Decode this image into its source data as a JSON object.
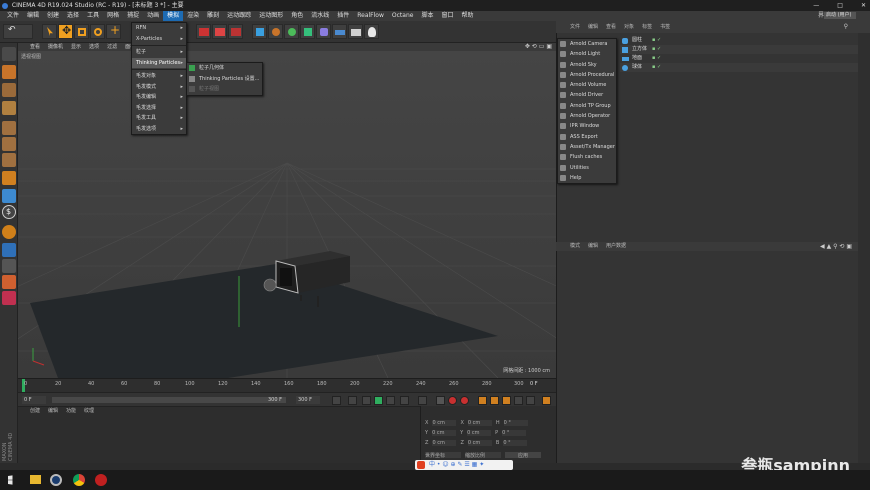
{
  "window": {
    "title": "CINEMA 4D R19.024 Studio (RC - R19) - [未标题 3 *] - 主要",
    "controls": [
      "—",
      "□",
      "✕"
    ]
  },
  "menubar": {
    "items": [
      "文件",
      "编辑",
      "创建",
      "选择",
      "工具",
      "网格",
      "捕捉",
      "动画",
      "模拟",
      "渲染",
      "雕刻",
      "运动跟踪",
      "运动图形",
      "角色",
      "流水线",
      "插件",
      "RealFlow",
      "Octane",
      "脚本",
      "窗口",
      "帮助"
    ],
    "active_index": 8,
    "layout_label": "界面",
    "layout_value": "启动 (用户)"
  },
  "viewport": {
    "menu": [
      "查看",
      "摄像机",
      "显示",
      "选项",
      "过滤",
      "面板"
    ],
    "camera_label": "透视视图",
    "grid_info": "网格间距 : 1000 cm"
  },
  "timeline": {
    "ticks": [
      "0",
      "20",
      "40",
      "60",
      "80",
      "100",
      "120",
      "140",
      "160",
      "180",
      "200",
      "220",
      "240",
      "260",
      "280",
      "300"
    ],
    "current_frame": "0 F"
  },
  "transport": {
    "start": "0 F",
    "end": "300 F",
    "end2": "300 F"
  },
  "materials": {
    "menu": [
      "创建",
      "编辑",
      "功能",
      "纹理"
    ]
  },
  "coords": {
    "rows": [
      [
        "X",
        "0 cm",
        "X",
        "0 cm",
        "H",
        "0 °"
      ],
      [
        "Y",
        "0 cm",
        "Y",
        "0 cm",
        "P",
        "0 °"
      ],
      [
        "Z",
        "0 cm",
        "Z",
        "0 cm",
        "B",
        "0 °"
      ]
    ],
    "mode_a": "世界坐标",
    "mode_b": "缩放比例",
    "apply": "应用"
  },
  "object_manager": {
    "menu": [
      "文件",
      "编辑",
      "查看",
      "对象",
      "标签",
      "书签"
    ],
    "objects": [
      "圆柱",
      "立方体",
      "地面",
      "球体"
    ]
  },
  "attribute_manager": {
    "menu": [
      "模式",
      "编辑",
      "用户数据"
    ]
  },
  "plugin_menu": {
    "items": [
      {
        "label": "RFN",
        "arrow": true
      },
      {
        "label": "X-Particles",
        "arrow": true
      },
      {
        "label": "粒子",
        "arrow": true
      },
      {
        "label": "Thinking Particles",
        "arrow": true,
        "highlight": true
      },
      {
        "label": "毛发对象",
        "arrow": true
      },
      {
        "label": "毛发模式",
        "arrow": true
      },
      {
        "label": "毛发编辑",
        "arrow": true
      },
      {
        "label": "毛发选择",
        "arrow": true
      },
      {
        "label": "毛发工具",
        "arrow": true
      },
      {
        "label": "毛发选项",
        "arrow": true
      }
    ]
  },
  "tp_submenu": {
    "items": [
      {
        "label": "粒子几何体",
        "disabled": false
      },
      {
        "label": "Thinking Particles 设置...",
        "disabled": false
      },
      {
        "label": "粒子视图",
        "disabled": true
      }
    ]
  },
  "arnold_menu": {
    "items": [
      "Arnold Camera",
      "Arnold Light",
      "Arnold Sky",
      "Arnold Procedural",
      "Arnold Volume",
      "Arnold Driver",
      "Arnold TP Group",
      "Arnold Operator",
      "IPR Window",
      "ASS Export",
      "Asset/Tx Manager",
      "Flush caches",
      "Utilities",
      "Help"
    ]
  },
  "watermark": "叁瓶sampinn",
  "colors": {
    "accent": "#1d6bb3",
    "floor": "#24282b",
    "viewport_bg": "#3d3d3d"
  }
}
